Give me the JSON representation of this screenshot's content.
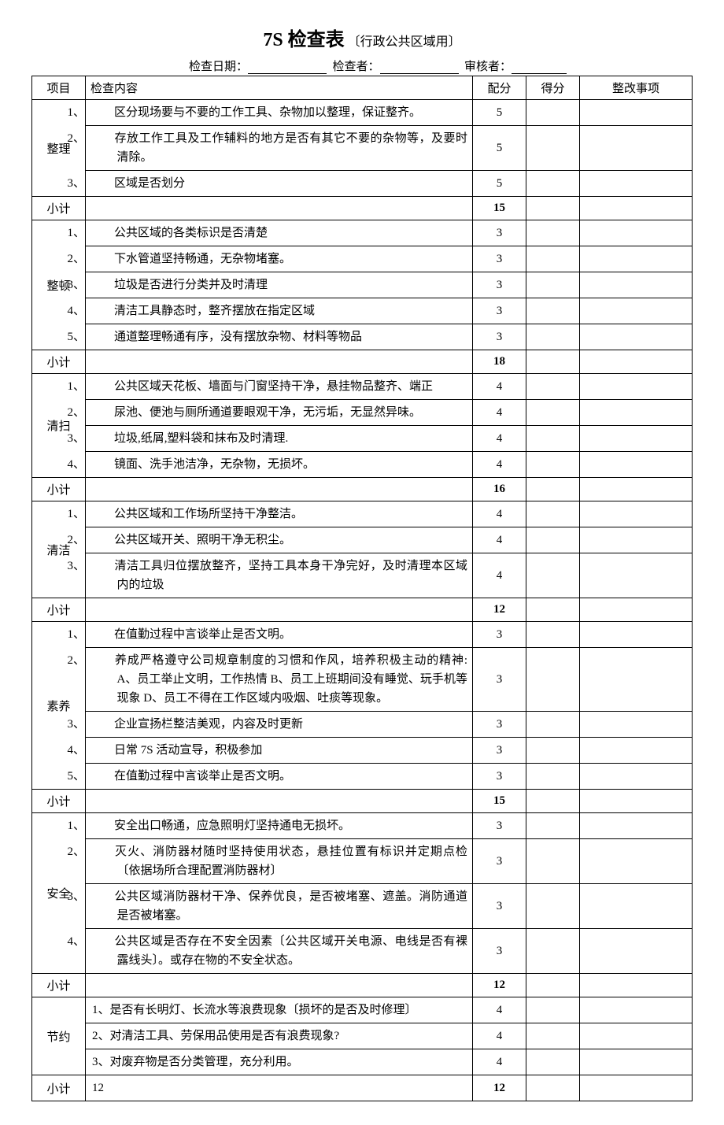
{
  "title_main": "7S 检查表",
  "title_sub": "〔行政公共区域用〕",
  "meta": {
    "date_label": "检查日期：",
    "checker_label": "检查者：",
    "reviewer_label": "审核者："
  },
  "headers": {
    "project": "项目",
    "content": "检查内容",
    "score": "配分",
    "got": "得分",
    "fix": "整改事项"
  },
  "subtotal_label": "小计",
  "sections": [
    {
      "name": "整理",
      "items": [
        {
          "num": "1、",
          "text": "区分现场要与不要的工作工具、杂物加以整理，保证整齐。",
          "score": "5"
        },
        {
          "num": "2、",
          "text": "存放工作工具及工作辅料的地方是否有其它不要的杂物等，及要时清除。",
          "score": "5"
        },
        {
          "num": "3、",
          "text": "区域是否划分",
          "score": "5"
        }
      ],
      "subtotal": "15"
    },
    {
      "name": "整顿",
      "items": [
        {
          "num": "1、",
          "text": "公共区域的各类标识是否清楚",
          "score": "3"
        },
        {
          "num": "2、",
          "text": "下水管道坚持畅通，无杂物堵塞。",
          "score": "3"
        },
        {
          "num": "3、",
          "text": "垃圾是否进行分类并及时清理",
          "score": "3"
        },
        {
          "num": "4、",
          "text": "清洁工具静态时，整齐摆放在指定区域",
          "score": "3"
        },
        {
          "num": "5、",
          "text": "通道整理畅通有序，没有摆放杂物、材料等物品",
          "score": "3"
        }
      ],
      "subtotal": "18"
    },
    {
      "name": "清扫",
      "items": [
        {
          "num": "1、",
          "text": "公共区域天花板、墙面与门窗坚持干净，悬挂物品整齐、端正",
          "score": "4"
        },
        {
          "num": "2、",
          "text": "尿池、便池与厕所通道要眼观干净，无污垢，无显然异味。",
          "score": "4"
        },
        {
          "num": "3、",
          "text": "垃圾,纸屑,塑料袋和抹布及时清理.",
          "score": "4"
        },
        {
          "num": "4、",
          "text": "镜面、洗手池洁净，无杂物，无损坏。",
          "score": "4"
        }
      ],
      "subtotal": "16"
    },
    {
      "name": "清洁",
      "items": [
        {
          "num": "1、",
          "text": "公共区域和工作场所坚持干净整洁。",
          "score": "4"
        },
        {
          "num": "2、",
          "text": "公共区域开关、照明干净无积尘。",
          "score": "4"
        },
        {
          "num": "3、",
          "text": "清洁工具归位摆放整齐，坚持工具本身干净完好，及时清理本区域内的垃圾",
          "score": "4"
        }
      ],
      "subtotal": "12"
    },
    {
      "name": "素养",
      "items": [
        {
          "num": "1、",
          "text": "在值勤过程中言谈举止是否文明。",
          "score": "3"
        },
        {
          "num": "2、",
          "text": "养成严格遵守公司规章制度的习惯和作风，培养积极主动的精神: A、员工举止文明，工作热情 B、员工上班期间没有睡觉、玩手机等现象 D、员工不得在工作区域内吸烟、吐痰等现象。",
          "score": "3"
        },
        {
          "num": "3、",
          "text": "企业宣扬栏整洁美观，内容及时更新",
          "score": "3"
        },
        {
          "num": "4、",
          "text": "日常 7S 活动宣导，积极参加",
          "score": "3"
        },
        {
          "num": "5、",
          "text": "在值勤过程中言谈举止是否文明。",
          "score": "3"
        }
      ],
      "subtotal": "15"
    },
    {
      "name": "安全",
      "items": [
        {
          "num": "1、",
          "text": "安全出口畅通，应急照明灯坚持通电无损坏。",
          "score": "3"
        },
        {
          "num": "2、",
          "text": "灭火、消防器材随时坚持使用状态，悬挂位置有标识并定期点检〔依据场所合理配置消防器材〕",
          "score": "3"
        },
        {
          "num": "3、",
          "text": "公共区域消防器材干净、保养优良，是否被堵塞、遮盖。消防通道是否被堵塞。",
          "score": "3"
        },
        {
          "num": "4、",
          "text": "公共区域是否存在不安全因素〔公共区域开关电源、电线是否有裸露线头〕。或存在物的不安全状态。",
          "score": "3"
        }
      ],
      "subtotal": "12"
    },
    {
      "name": "节约",
      "items": [
        {
          "num": "1、",
          "text": "是否有长明灯、长流水等浪费现象〔损坏的是否及时修理〕",
          "score": "4"
        },
        {
          "num": "2、",
          "text": "对清洁工具、劳保用品使用是否有浪费现象?",
          "score": "4"
        },
        {
          "num": "3、",
          "text": "对废弃物是否分类管理，充分利用。",
          "score": "4"
        }
      ],
      "subtotal": "12",
      "subtotal_content": "12"
    }
  ]
}
